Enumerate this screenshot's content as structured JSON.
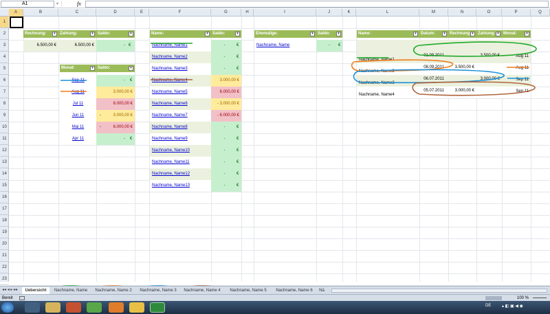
{
  "formula_bar": {
    "name_box": "A1",
    "fx": "fx",
    "value": ""
  },
  "columns": [
    "A",
    "B",
    "C",
    "D",
    "E",
    "F",
    "G",
    "H",
    "I",
    "J",
    "K",
    "L",
    "M",
    "N",
    "O",
    "P",
    "Q"
  ],
  "rows": [
    "1",
    "2",
    "3",
    "4",
    "5",
    "6",
    "7",
    "8",
    "9",
    "10",
    "11",
    "12",
    "13",
    "14",
    "15",
    "16",
    "17",
    "18",
    "19",
    "20",
    "21",
    "22",
    "23"
  ],
  "table_rechnung": {
    "headers": [
      "Rechnung:",
      "Zahlung:",
      "Saldo:"
    ],
    "rechnung": "6.500,00 €",
    "zahlung": "6.500,00 €",
    "saldo_dash": "-",
    "saldo_cur": "€"
  },
  "table_monat": {
    "headers": [
      "Monat:",
      "Saldo:"
    ],
    "rows": [
      {
        "month": "Sep 11",
        "dash": "",
        "value": "-",
        "cur": "€",
        "status": "green"
      },
      {
        "month": "Aug 11",
        "dash": "",
        "value": "3.000,00 €",
        "cur": "",
        "status": "yellow"
      },
      {
        "month": "Jul 11",
        "dash": "",
        "value": "6.000,00 €",
        "cur": "",
        "status": "pink"
      },
      {
        "month": "Jun 11",
        "dash": "-",
        "value": "3.000,00 €",
        "cur": "",
        "status": "yellow"
      },
      {
        "month": "Mai 11",
        "dash": "-",
        "value": "6.000,00 €",
        "cur": "",
        "status": "pink"
      },
      {
        "month": "Apr 11",
        "dash": "",
        "value": "-",
        "cur": "€",
        "status": "green"
      }
    ]
  },
  "table_names": {
    "headers": [
      "Name:",
      "Saldo:"
    ],
    "rows": [
      {
        "name": "Nachname, Name1",
        "value": "-",
        "cur": "€",
        "status": "green"
      },
      {
        "name": "Nachname, Name2",
        "value": "-",
        "cur": "€",
        "status": "green"
      },
      {
        "name": "Nachname, Name3",
        "value": "-",
        "cur": "€",
        "status": "green"
      },
      {
        "name": "Nachname, Name4",
        "value": "3.000,00 €",
        "cur": "",
        "status": "yellow"
      },
      {
        "name": "Nachname, Name5",
        "value": "6.000,00 €",
        "cur": "",
        "status": "pink"
      },
      {
        "name": "Nachname, Name6",
        "value": "- 3.000,00 €",
        "cur": "",
        "status": "yellow"
      },
      {
        "name": "Nachname, Name7",
        "value": "- 6.000,00 €",
        "cur": "",
        "status": "pink"
      },
      {
        "name": "Nachname, Name8",
        "value": "-",
        "cur": "€",
        "status": "green"
      },
      {
        "name": "Nachname, Name9",
        "value": "-",
        "cur": "€",
        "status": "green"
      },
      {
        "name": "Nachname, Name10",
        "value": "-",
        "cur": "€",
        "status": "green"
      },
      {
        "name": "Nachname, Name11",
        "value": "-",
        "cur": "€",
        "status": "green"
      },
      {
        "name": "Nachname, Name12",
        "value": "-",
        "cur": "€",
        "status": "green"
      },
      {
        "name": "Nachname, Name13",
        "value": "-",
        "cur": "€",
        "status": "green"
      }
    ]
  },
  "table_ehemalige": {
    "headers": [
      "Ehemalige:",
      "Saldo:"
    ],
    "name": "Nachname, Name",
    "value": "-",
    "cur": "€"
  },
  "table_detail": {
    "headers": [
      "Name:",
      "Datum:",
      "Rechnung:",
      "Zahlung:",
      "Monat:"
    ],
    "rows": [
      {
        "name": "Nachname, Name1",
        "datum": "01.09.2011",
        "rechnung": "",
        "zahlung": "3.500,00 €",
        "monat": "Aug 11"
      },
      {
        "name": "Nachname, Name2",
        "datum": "08.09.2011",
        "rechnung": "3.500,00 €",
        "zahlung": "",
        "monat": "Aug 11"
      },
      {
        "name": "Nachname, Name3",
        "datum": "06.07.2011",
        "rechnung": "",
        "zahlung": "3.000,00 €",
        "monat": "Sep 11"
      },
      {
        "name": "Nachname, Name4",
        "datum": "05.07.2011",
        "rechnung": "3.000,00 €",
        "zahlung": "",
        "monat": "Sep 11"
      }
    ]
  },
  "sheet_tabs": [
    "Uebersicht",
    "Nachname, Name",
    "Nachname, Name 2",
    "Nachname, Name 3",
    "Nachname, Name 4",
    "Nachname, Name 5",
    "Nachname, Name 6",
    "Nä"
  ],
  "status": {
    "ready": "Bereit",
    "zoom": "100 %"
  },
  "taskbar": {
    "lang": "DE",
    "time": ""
  },
  "annotation_colors": {
    "green": "#1faa2b",
    "orange": "#f07b1a",
    "blue": "#1a8fd8",
    "brown": "#b0643c",
    "header": "#9bbb59"
  }
}
